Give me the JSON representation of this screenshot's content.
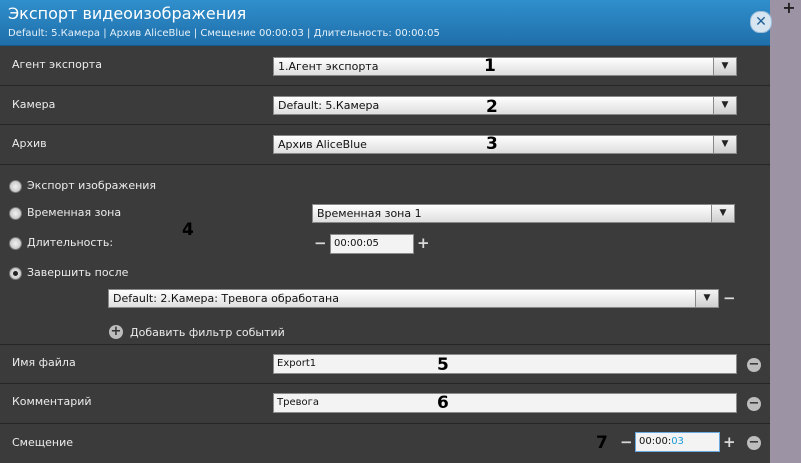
{
  "window": {
    "title": "Экспорт видеоизображения",
    "subtitle": "Default: 5.Камера | Архив AliceBlue | Смещение 00:00:03 | Длительность: 00:00:05",
    "close_symbol": "✕",
    "side_button_symbol": "+"
  },
  "fields": {
    "agent": {
      "label": "Агент экспорта",
      "value": "1.Агент экспорта",
      "marker": "1"
    },
    "camera": {
      "label": "Камера",
      "value": "Default: 5.Камера",
      "marker": "2"
    },
    "archive": {
      "label": "Архив",
      "value": "Архив AliceBlue",
      "marker": "3"
    }
  },
  "mode": {
    "marker": "4",
    "options": [
      {
        "label": "Экспорт изображения",
        "selected": false
      },
      {
        "label": "Временная зона",
        "selected": false
      },
      {
        "label": "Длительность:",
        "selected": false
      },
      {
        "label": "Завершить после",
        "selected": true
      }
    ],
    "time_zone_value": "Временная зона 1",
    "duration_value": "00:00:05",
    "event_filter_value": "Default: 2.Камера: Тревога обработана",
    "add_filter_label": "Добавить фильтр событий"
  },
  "filename": {
    "label": "Имя файла",
    "value": "Export1",
    "marker": "5"
  },
  "comment": {
    "label": "Комментарий",
    "value": "Тревога",
    "marker": "6"
  },
  "offset": {
    "label": "Смещение",
    "value_main": "00:00:",
    "value_sec": "03",
    "marker": "7"
  },
  "symbols": {
    "minus": "−",
    "plus": "+",
    "arrow": "▼"
  },
  "colors": {
    "header": "#2a85c4",
    "panel": "#3b3b3b",
    "side": "#a59cac"
  }
}
